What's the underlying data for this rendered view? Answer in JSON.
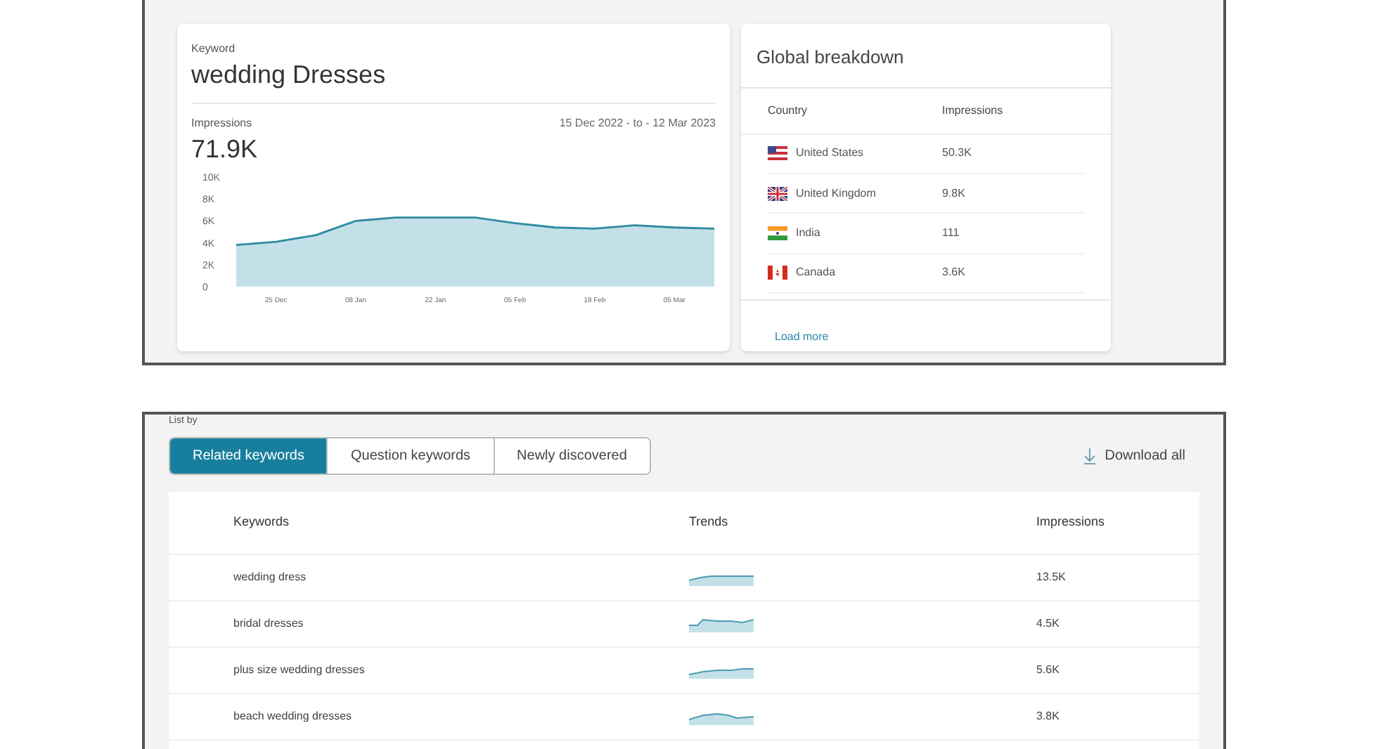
{
  "keyword_card": {
    "label": "Keyword",
    "keyword": "wedding Dresses",
    "metric_label": "Impressions",
    "date_range": "15 Dec 2022 - to - 12 Mar 2023",
    "total": "71.9K",
    "chart_data": {
      "type": "area",
      "categories": [
        null,
        "25 Dec",
        null,
        "08 Jan",
        null,
        "22 Jan",
        null,
        "05 Feb",
        null,
        "19 Feb",
        null,
        "05 Mar",
        null
      ],
      "series": [
        {
          "color": "#2e8aa0",
          "values": [
            3800,
            4100,
            4700,
            6000,
            6300,
            6300,
            6300,
            5800,
            5400,
            5300,
            5600,
            5400,
            5300
          ]
        }
      ],
      "ylim": [
        0,
        10000
      ],
      "yticks": [
        {
          "value": 0,
          "label": "0"
        },
        {
          "value": 2000,
          "label": "2K"
        },
        {
          "value": 4000,
          "label": "4K"
        },
        {
          "value": 6000,
          "label": "6K"
        },
        {
          "value": 8000,
          "label": "8K"
        },
        {
          "value": 10000,
          "label": "10K"
        }
      ]
    }
  },
  "global_breakdown": {
    "title": "Global breakdown",
    "columns": [
      "Country",
      "Impressions"
    ],
    "rows": [
      {
        "kind": "us",
        "country": "United States",
        "impressions": "50.3K"
      },
      {
        "kind": "uk",
        "country": "United Kingdom",
        "impressions": "9.8K"
      },
      {
        "kind": "india",
        "country": "India",
        "impressions": "111"
      },
      {
        "kind": "canada",
        "country": "Canada",
        "impressions": "3.6K"
      }
    ],
    "load_more": "Load more"
  },
  "list_by_label": "List by",
  "tabs": [
    {
      "label": "Related keywords",
      "selected": true
    },
    {
      "label": "Question keywords",
      "selected": false
    },
    {
      "label": "Newly discovered",
      "selected": false
    }
  ],
  "download_all": "Download all",
  "keywords_table": {
    "columns": [
      "Keywords",
      "Trends",
      "Impressions"
    ],
    "rows": [
      {
        "keyword": "wedding dress",
        "impressions": "13.5K"
      },
      {
        "keyword": "bridal dresses",
        "impressions": "4.5K"
      },
      {
        "keyword": "plus size wedding dresses",
        "impressions": "5.6K"
      },
      {
        "keyword": "beach wedding dresses",
        "impressions": "3.8K"
      }
    ]
  }
}
